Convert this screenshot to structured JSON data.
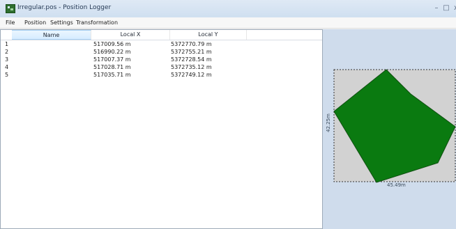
{
  "window": {
    "title": "Irregular.pos - Position Logger",
    "controls": {
      "minimize": "–",
      "maximize": "□",
      "close": "x"
    }
  },
  "menu": [
    "File",
    "Position",
    "Settings",
    "Transformation"
  ],
  "table": {
    "columns": [
      "Name",
      "Local X",
      "Local Y"
    ],
    "rows": [
      {
        "name": "1",
        "x": "517009.56 m",
        "y": "5372770.79 m"
      },
      {
        "name": "2",
        "x": "516990.22 m",
        "y": "5372755.21 m"
      },
      {
        "name": "3",
        "x": "517007.37 m",
        "y": "5372728.54 m"
      },
      {
        "name": "4",
        "x": "517028.71 m",
        "y": "5372735.12 m"
      },
      {
        "name": "5",
        "x": "517035.71 m",
        "y": "5372749.12 m"
      }
    ]
  },
  "map": {
    "width_label": "45.49m",
    "height_label": "42.25m",
    "fill_color": "#0a7a10",
    "frame_color": "#d2d2d2"
  }
}
